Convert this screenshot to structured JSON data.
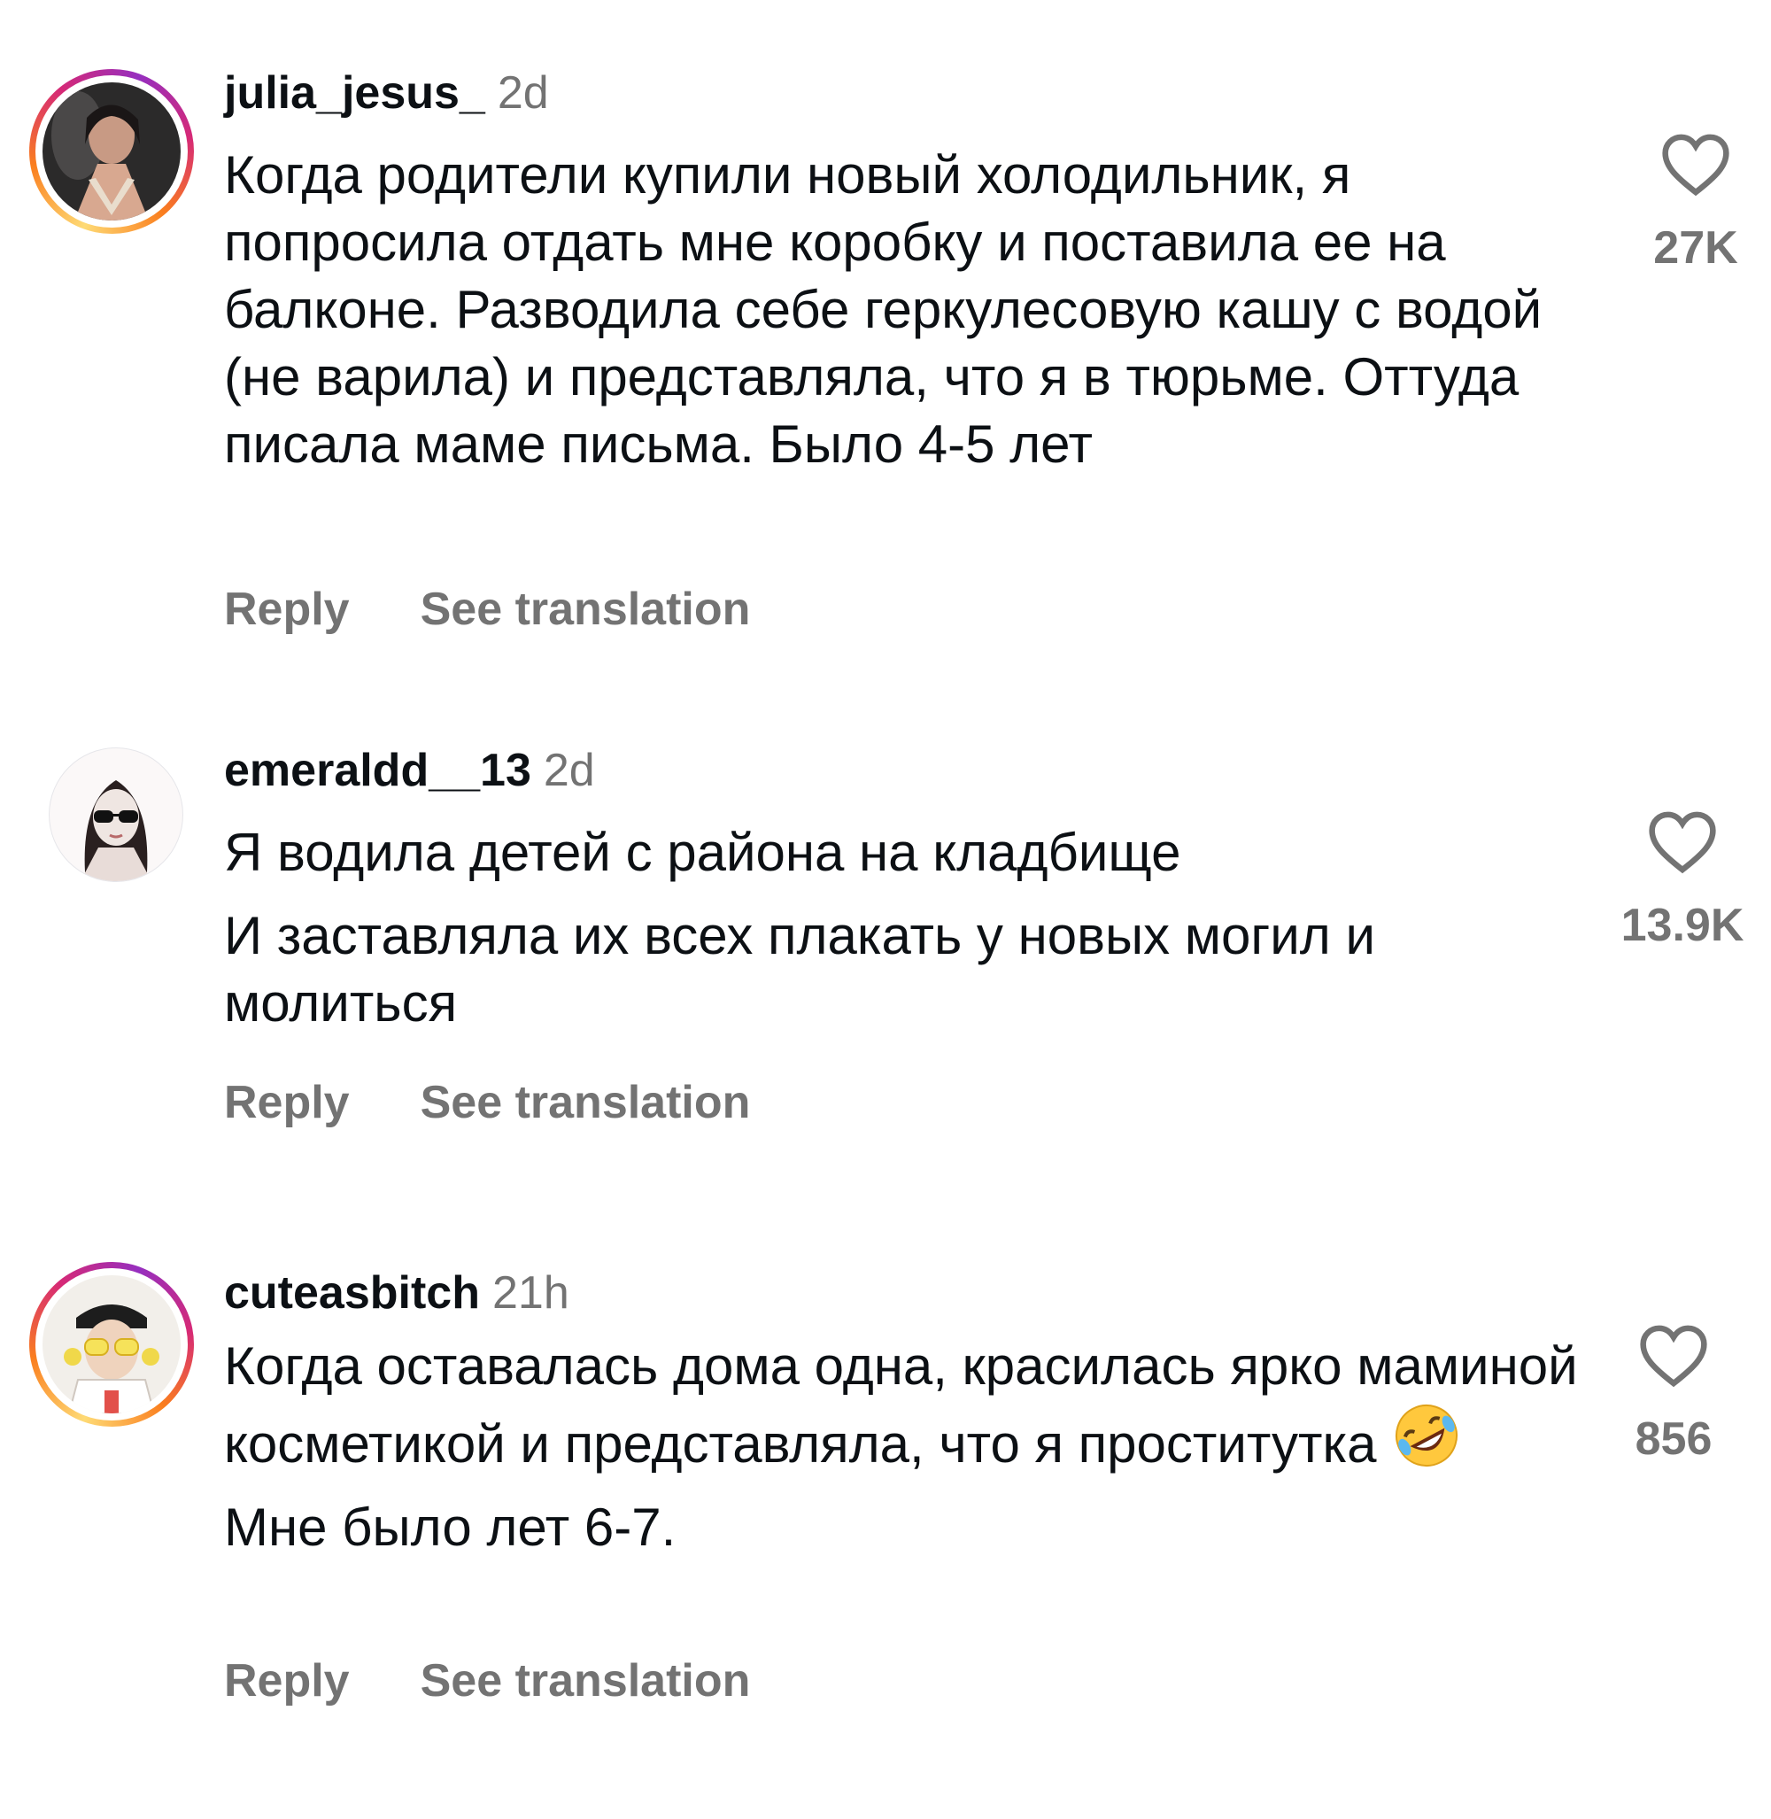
{
  "comments": [
    {
      "username": "julia_jesus_",
      "time": "2d",
      "lines": [
        "Когда родители купили новый холодильник, я попросила отдать мне коробку и поставила ее на балконе. Разводила себе геркулесовую кашу с водой (не варила) и представляла, что я в тюрьме. Оттуда писала маме письма. Было 4-5 лет"
      ],
      "likes": "27K",
      "reply_label": "Reply",
      "translate_label": "See translation",
      "avatar_ring": "story"
    },
    {
      "username": "emeraldd__13",
      "time": "2d",
      "lines": [
        "Я водила детей с района на кладбище",
        "И заставляла их всех плакать у новых могил и молиться"
      ],
      "likes": "13.9K",
      "reply_label": "Reply",
      "translate_label": "See translation",
      "avatar_ring": "none"
    },
    {
      "username": "cuteasbitch",
      "time": "21h",
      "lines": [
        "Когда оставалась дома одна, красилась ярко маминой косметикой и представляла, что я проститутка",
        "Мне было лет 6-7."
      ],
      "emoji_after_line_1": "rolling-on-floor-laughing-emoji",
      "likes": "856",
      "reply_label": "Reply",
      "translate_label": "See translation",
      "avatar_ring": "story"
    }
  ],
  "icons": {
    "like": "heart-outline-icon"
  },
  "colors": {
    "text_primary": "#0c1014",
    "text_secondary": "#737373",
    "background": "#ffffff"
  }
}
